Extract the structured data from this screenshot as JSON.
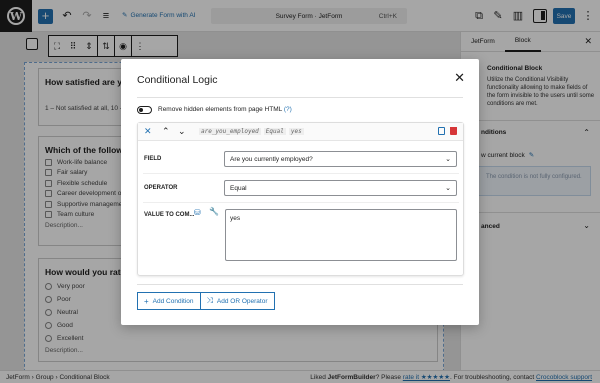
{
  "topbar": {
    "wp_logo": "W",
    "add_icon": "+",
    "generate_form": "Generate Form with AI",
    "doc_title": "Survey Form · JetForm",
    "shortcut": "Ctrl+K",
    "save_label": "Save"
  },
  "canvas": {
    "cards": [
      {
        "title": "How satisfied are you",
        "line": "1 – Not satisfied at all, 10 -"
      },
      {
        "title": "Which of the followin",
        "options": [
          "Work-life balance",
          "Fair salary",
          "Flexible schedule",
          "Career development o",
          "Supportive manageme",
          "Team culture"
        ],
        "desc": "Description..."
      },
      {
        "title": "How would you rate",
        "options": [
          "Very poor",
          "Poor",
          "Neutral",
          "Good",
          "Excellent"
        ],
        "desc": "Description..."
      }
    ]
  },
  "sidebar": {
    "tabs": [
      "JetForm",
      "Block"
    ],
    "block_title": "Conditional Block",
    "block_desc": "Utilize the Conditional Visibility functionality allowing to make fields of the form invisible to the users until some conditions are met.",
    "conditions_heading": "nditions",
    "current_block": "w current block",
    "warning": "The condition is not fully configured.",
    "advanced_heading": "anced"
  },
  "status": {
    "breadcrumb": "JetForm  ›  Group  ›  Conditional Block",
    "liked_prefix": "Liked ",
    "liked_brand": "JetFormBuilder",
    "liked_mid": "? Please ",
    "rate_link": "rate it ★★★★★",
    "support_text": ". For troubleshooting, contact ",
    "support_link": "Crocoblock support"
  },
  "modal": {
    "title": "Conditional Logic",
    "toggle_label": "Remove hidden elements from page HTML",
    "toggle_help": "(?)",
    "condition": {
      "summary_field": "are_you_employed",
      "summary_operator": "Equal",
      "summary_value": "yes",
      "field_label": "FIELD",
      "field_value": "Are you currently employed?",
      "operator_label": "OPERATOR",
      "operator_value": "Equal",
      "value_label": "VALUE TO COM...",
      "value_text": "yes"
    },
    "add_condition": "Add Condition",
    "add_or": "Add OR Operator"
  }
}
